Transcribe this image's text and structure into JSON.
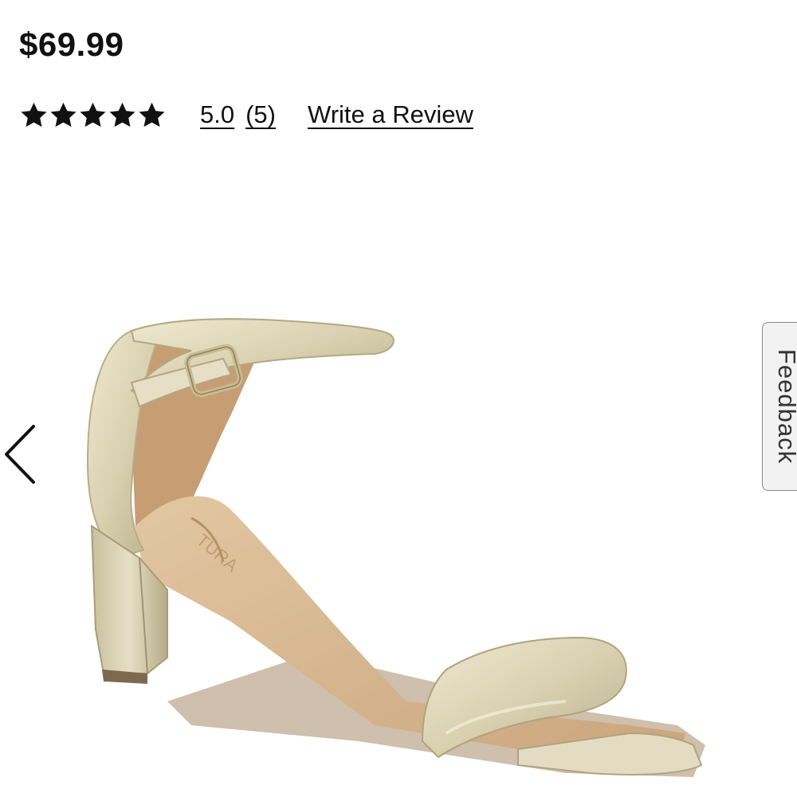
{
  "product": {
    "price": "$69.99"
  },
  "rating": {
    "stars": 5,
    "max_stars": 5,
    "value_label": "5.0",
    "count_label": "(5)",
    "write_review_label": "Write a Review"
  },
  "gallery": {
    "image_icon": "gold-block-heel-sandal-image",
    "prev_icon": "chevron-left-icon"
  },
  "feedback": {
    "label": "Feedback"
  },
  "colors": {
    "text": "#111111",
    "sandal_gold": "#d9d2b4",
    "insole_tan": "#d7b894",
    "feedback_bg": "#f2f2f2"
  }
}
